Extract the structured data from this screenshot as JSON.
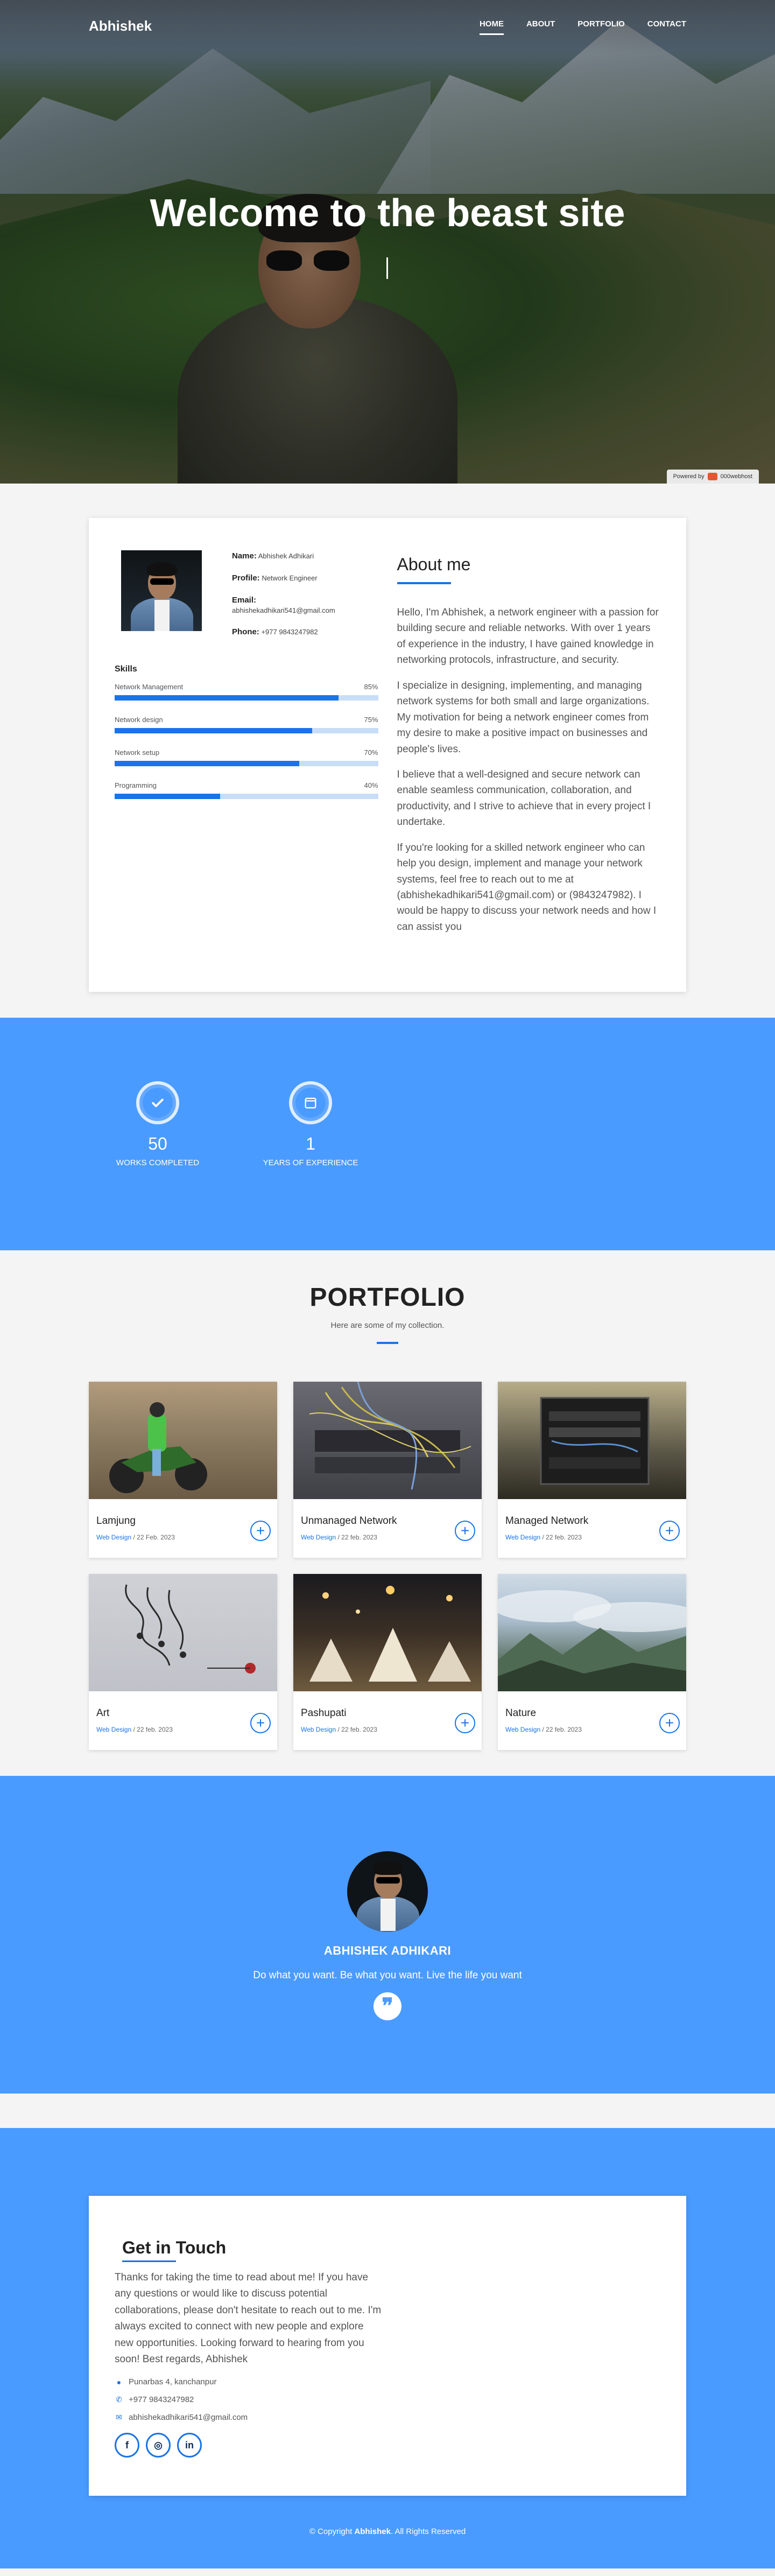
{
  "nav": {
    "brand": "Abhishek",
    "items": [
      {
        "label": "HOME",
        "active": true
      },
      {
        "label": "ABOUT",
        "active": false
      },
      {
        "label": "PORTFOLIO",
        "active": false
      },
      {
        "label": "CONTACT",
        "active": false
      }
    ]
  },
  "hero": {
    "title": "Welcome to the beast site",
    "powered": "Powered by",
    "powered_brand": "000webhost"
  },
  "about": {
    "name_label": "Name:",
    "name": "Abhishek Adhikari",
    "profile_label": "Profile:",
    "profile": "Network Engineer",
    "email_label": "Email:",
    "email": "abhishekadhikari541@gmail.com",
    "phone_label": "Phone:",
    "phone": "+977 9843247982",
    "skills_title": "Skills",
    "skills": [
      {
        "name": "Network Management",
        "percent_label": "85%",
        "value": 85
      },
      {
        "name": "Network design",
        "percent_label": "75%",
        "value": 75
      },
      {
        "name": "Network setup",
        "percent_label": "70%",
        "value": 70
      },
      {
        "name": "Programming",
        "percent_label": "40%",
        "value": 40
      }
    ],
    "title": "About me",
    "paragraphs": [
      "Hello, I'm Abhishek, a network engineer with a passion for building secure and reliable networks. With over 1 years of experience in the industry, I have gained knowledge in networking protocols, infrastructure, and security.",
      "I specialize in designing, implementing, and managing network systems for both small and large organizations. My motivation for being a network engineer comes from my desire to make a positive impact on businesses and people's lives.",
      "I believe that a well-designed and secure network can enable seamless communication, collaboration, and productivity, and I strive to achieve that in every project I undertake.",
      "If you're looking for a skilled network engineer who can help you design, implement and manage your network systems, feel free to reach out to me at (abhishekadhikari541@gmail.com) or (9843247982). I would be happy to discuss your network needs and how I can assist you"
    ]
  },
  "counts": [
    {
      "number": "50",
      "label": "WORKS COMPLETED",
      "icon": "check-icon"
    },
    {
      "number": "1",
      "label": "YEARS OF EXPERIENCE",
      "icon": "calendar-icon"
    }
  ],
  "portfolio": {
    "title": "PORTFOLIO",
    "subtitle": "Here are some of my collection.",
    "items": [
      {
        "name": "Lamjung",
        "category": "Web Design",
        "date": "/ 22 Feb. 2023"
      },
      {
        "name": "Unmanaged Network",
        "category": "Web Design",
        "date": "/ 22 feb. 2023"
      },
      {
        "name": "Managed Network",
        "category": "Web Design",
        "date": "/ 22 feb. 2023"
      },
      {
        "name": "Art",
        "category": "Web Design",
        "date": "/ 22 feb. 2023"
      },
      {
        "name": "Pashupati",
        "category": "Web Design",
        "date": "/ 22 feb. 2023"
      },
      {
        "name": "Nature",
        "category": "Web Design",
        "date": "/ 22 feb. 2023"
      }
    ]
  },
  "quote": {
    "name": "ABHISHEK ADHIKARI",
    "text": "Do what you want. Be what you want. Live the life you want",
    "icon": "quote-icon"
  },
  "contact": {
    "title": "Get in Touch",
    "text": "Thanks for taking the time to read about me! If you have any questions or would like to discuss potential collaborations, please don't hesitate to reach out to me. I'm always excited to connect with new people and explore new opportunities. Looking forward to hearing from you soon! Best regards, Abhishek",
    "address": "Punarbas 4, kanchanpur",
    "phone": "+977 9843247982",
    "email": "abhishekadhikari541@gmail.com",
    "socials": [
      "facebook-icon",
      "instagram-icon",
      "linkedin-icon"
    ]
  },
  "footer": {
    "prefix": "© Copyright",
    "name": "Abhishek",
    "suffix": ". All Rights Reserved"
  },
  "colors": {
    "accent": "#1a73e8",
    "section_blue": "#4a9bff",
    "page_bg": "#f4f4f4"
  }
}
